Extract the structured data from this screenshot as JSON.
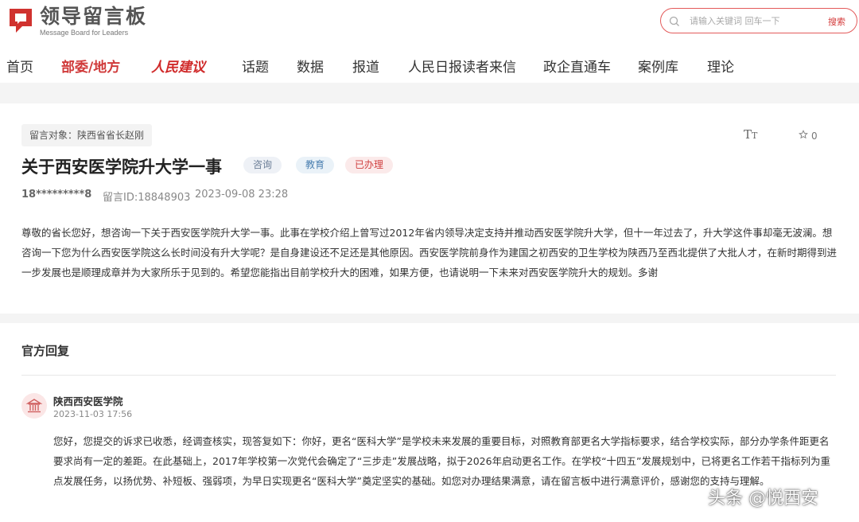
{
  "logo": {
    "title": "领导留言板",
    "subtitle": "Message Board for Leaders"
  },
  "search": {
    "placeholder": "请输入关键词 回车一下",
    "button_label": "搜索"
  },
  "nav": {
    "items": [
      {
        "label": "首页"
      },
      {
        "label": "部委/地方",
        "active": true
      },
      {
        "label": "人民建议"
      },
      {
        "label": "话题"
      },
      {
        "label": "数据"
      },
      {
        "label": "报道"
      },
      {
        "label": "人民日报读者来信"
      },
      {
        "label": "政企直通车"
      },
      {
        "label": "案例库"
      },
      {
        "label": "理论"
      }
    ]
  },
  "message": {
    "target": "留言对象：陕西省省长赵刚",
    "title": "关于西安医学院升大学一事",
    "tags": [
      "咨询",
      "教育",
      "已办理"
    ],
    "user": "18*********8",
    "id": "留言ID:18848903",
    "date": "2023-09-08 23:28",
    "favorite_count": "0",
    "body": "尊敬的省长您好，想咨询一下关于西安医学院升大学一事。此事在学校介绍上曾写过2012年省内领导决定支持并推动西安医学院升大学，但十一年过去了，升大学这件事却毫无波澜。想咨询一下您为什么西安医学院这么长时间没有升大学呢？是自身建设还不足还是其他原因。西安医学院前身作为建国之初西安的卫生学校为陕西乃至西北提供了大批人才，在新时期得到进一步发展也是顺理成章并为大家所乐于见到的。希望您能指出目前学校升大的困难，如果方便，也请说明一下未来对西安医学院升大的规划。多谢"
  },
  "reply": {
    "heading": "官方回复",
    "org": "陕西西安医学院",
    "date": "2023-11-03 17:56",
    "body": "您好，您提交的诉求已收悉，经调查核实，现答复如下：你好，更名“医科大学”是学校未来发展的重要目标，对照教育部更名大学指标要求，结合学校实际，部分办学条件距更名要求尚有一定的差距。在此基础上，2017年学校第一次党代会确定了“三步走”发展战略，拟于2026年启动更名工作。在学校“十四五”发展规划中，已将更名工作若干指标列为重点发展任务，以扬优势、补短板、强弱项，为早日实现更名“医科大学”奠定坚实的基础。如您对办理结果满意，请在留言板中进行满意评价，感谢您的支持与理解。"
  },
  "watermark": "头条 @悦西安",
  "colors": {
    "accent": "#d03a3a",
    "tag_consult": "#6a7d96",
    "tag_edu": "#4a7fb0",
    "tag_done": "#d04040"
  }
}
